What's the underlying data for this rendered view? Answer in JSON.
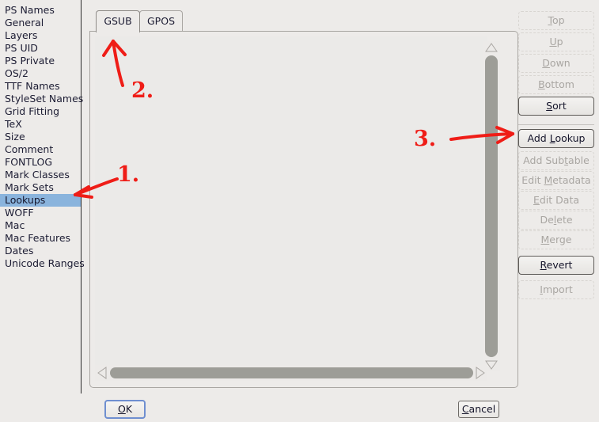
{
  "sidebar": {
    "items": [
      {
        "label": "PS Names",
        "selected": false
      },
      {
        "label": "General",
        "selected": false
      },
      {
        "label": "Layers",
        "selected": false
      },
      {
        "label": "PS UID",
        "selected": false
      },
      {
        "label": "PS Private",
        "selected": false
      },
      {
        "label": "OS/2",
        "selected": false
      },
      {
        "label": "TTF Names",
        "selected": false
      },
      {
        "label": "StyleSet Names",
        "selected": false
      },
      {
        "label": "Grid Fitting",
        "selected": false
      },
      {
        "label": "TeX",
        "selected": false
      },
      {
        "label": "Size",
        "selected": false
      },
      {
        "label": "Comment",
        "selected": false
      },
      {
        "label": "FONTLOG",
        "selected": false
      },
      {
        "label": "Mark Classes",
        "selected": false
      },
      {
        "label": "Mark Sets",
        "selected": false
      },
      {
        "label": "Lookups",
        "selected": true
      },
      {
        "label": "WOFF",
        "selected": false
      },
      {
        "label": "Mac",
        "selected": false
      },
      {
        "label": "Mac Features",
        "selected": false
      },
      {
        "label": "Dates",
        "selected": false
      },
      {
        "label": "Unicode Ranges",
        "selected": false
      }
    ]
  },
  "tabs": [
    {
      "label": "GSUB",
      "active": true
    },
    {
      "label": "GPOS",
      "active": false
    }
  ],
  "lookup_list": {
    "rows": [],
    "empty": true
  },
  "buttons": [
    {
      "label": "Top",
      "mnemonic": "T",
      "enabled": false
    },
    {
      "label": "Up",
      "mnemonic": "U",
      "enabled": false
    },
    {
      "label": "Down",
      "mnemonic": "D",
      "enabled": false
    },
    {
      "label": "Bottom",
      "mnemonic": "B",
      "enabled": false
    },
    {
      "label": "Sort",
      "mnemonic": "S",
      "enabled": true
    },
    {
      "label": "Add Lookup",
      "mnemonic": "L",
      "enabled": true
    },
    {
      "label": "Add Subtable",
      "mnemonic": "t",
      "enabled": false
    },
    {
      "label": "Edit Metadata",
      "mnemonic": "M",
      "enabled": false
    },
    {
      "label": "Edit Data",
      "mnemonic": "E",
      "enabled": false
    },
    {
      "label": "Delete",
      "mnemonic": "l",
      "enabled": false
    },
    {
      "label": "Merge",
      "mnemonic": "M",
      "enabled": false
    },
    {
      "label": "Revert",
      "mnemonic": "R",
      "enabled": true
    },
    {
      "label": "Import",
      "mnemonic": "I",
      "enabled": false
    }
  ],
  "footer": {
    "ok_label": "OK",
    "ok_mnemonic": "O",
    "cancel_label": "Cancel",
    "cancel_mnemonic": "C"
  },
  "annotations": [
    {
      "text": "1.",
      "target": "sidebar-item-lookups"
    },
    {
      "text": "2.",
      "target": "tab-gsub"
    },
    {
      "text": "3.",
      "target": "add-lookup-button"
    }
  ],
  "colors": {
    "selection": "#8ab4dd",
    "annotation": "#ef1d17",
    "dialog_bg": "#edebe9",
    "focus_ring": "#6f8fd0",
    "scrollbar_thumb": "#9d9d97"
  }
}
